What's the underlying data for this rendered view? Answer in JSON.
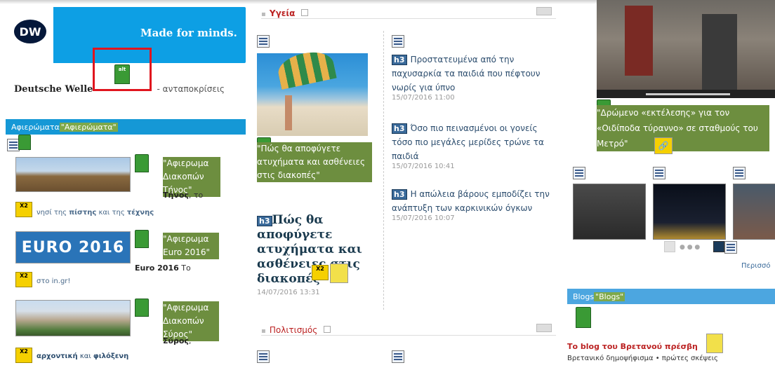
{
  "dw": {
    "logo_text": "DW",
    "tagline": "Made for minds.",
    "title": "Deutsche Welle",
    "subtitle": "- ανταποκρίσεις",
    "alt_icon_label": "alt"
  },
  "sidebar": {
    "section_label": "Αφιερώματα",
    "section_label_hl": "\"Αφιερώματα\"",
    "items": [
      {
        "alt_text": "\"Αφιερωμα Διακοπών Τήνος\"",
        "title": "Τήνος",
        "title_rest": ", το",
        "desc_pre": "νησί της ",
        "desc_b1": "πίστης",
        "desc_mid": " και της ",
        "desc_b2": "τέχνης",
        "thumb_caption": ""
      },
      {
        "alt_text": "\"Αφιερωμα Euro 2016\"",
        "title": "Euro 2016",
        "title_rest": " Το",
        "desc_pre": "στο in.gr!",
        "thumb_caption": "EURO 2016"
      },
      {
        "alt_text": "\"Αφιερωμα Διακοπών Σύρος\"",
        "title": "Σύρος",
        "title_rest": ",",
        "desc_pre": "",
        "desc_b1": "αρχοντική",
        "desc_mid": " και ",
        "desc_b2": "φιλόξενη"
      }
    ],
    "x2_label": "X2"
  },
  "health": {
    "header": "Υγεία",
    "feature_alt": "\"Πώς θα αποφύγετε ατυχήματα και ασθένειες στις διακοπές\"",
    "feature_h3": "h3",
    "feature_title": "Πώς θα αποφύγετε ατυχήματα και ασθένειες στις διακοπές",
    "feature_date": "14/07/2016 13:31",
    "news": [
      {
        "h3": "h3",
        "title": "Προστατευμένα από την παχυσαρκία τα παιδιά που πέφτουν νωρίς για ύπνο",
        "date": "15/07/2016 11:00"
      },
      {
        "h3": "h3",
        "title": "Όσο πιο πεινασμένοι οι γονείς τόσο πιο μεγάλες μερίδες τρώνε τα παιδιά",
        "date": "15/07/2016 10:41"
      },
      {
        "h3": "h3",
        "title": "Η απώλεια βάρους εμποδίζει την ανάπτυξη των καρκινικών όγκων",
        "date": "15/07/2016 10:07"
      }
    ]
  },
  "culture": {
    "header": "Πολιτισμός"
  },
  "right": {
    "video_alt": "\"Δρώμενο «εκτέλεσης» για τον «Οιδίποδα τύραννο» σε σταθμούς του Μετρό\"",
    "more_label": "Περισσό",
    "blogs_label": "Blogs",
    "blogs_label_hl": "\"Blogs\"",
    "blog_title": "Το blog του Βρετανού πρέσβη",
    "blog_desc": "Βρετανικό δημοψήφισμα • πρώτες σκέψεις"
  }
}
